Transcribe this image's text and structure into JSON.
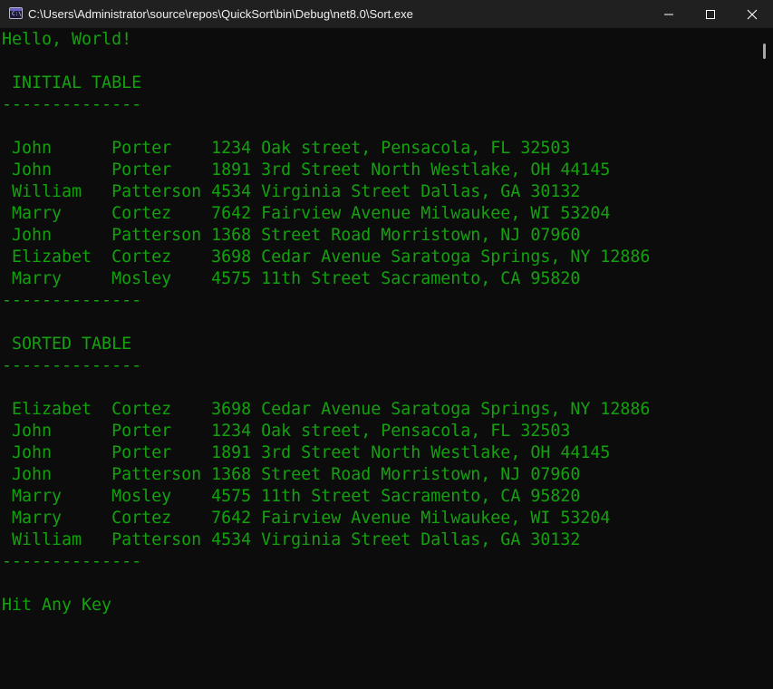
{
  "window": {
    "title": "C:\\Users\\Administrator\\source\\repos\\QuickSort\\bin\\Debug\\net8.0\\Sort.exe",
    "icon": "console-app-icon",
    "icon_glyph": "C:\\"
  },
  "controls": {
    "minimize": "minimize-icon",
    "maximize": "maximize-icon",
    "close": "close-icon"
  },
  "colors": {
    "text": "#13a10e",
    "background": "#0c0c0c",
    "titlebar": "#202020"
  },
  "console": {
    "lines": [
      "Hello, World!",
      "",
      " INITIAL TABLE",
      "--------------",
      "",
      " John      Porter    1234 Oak street, Pensacola, FL 32503",
      " John      Porter    1891 3rd Street North Westlake, OH 44145",
      " William   Patterson 4534 Virginia Street Dallas, GA 30132",
      " Marry     Cortez    7642 Fairview Avenue Milwaukee, WI 53204",
      " John      Patterson 1368 Street Road Morristown, NJ 07960",
      " Elizabet  Cortez    3698 Cedar Avenue Saratoga Springs, NY 12886",
      " Marry     Mosley    4575 11th Street Sacramento, CA 95820",
      "--------------",
      "",
      " SORTED TABLE",
      "--------------",
      "",
      " Elizabet  Cortez    3698 Cedar Avenue Saratoga Springs, NY 12886",
      " John      Porter    1234 Oak street, Pensacola, FL 32503",
      " John      Porter    1891 3rd Street North Westlake, OH 44145",
      " John      Patterson 1368 Street Road Morristown, NJ 07960",
      " Marry     Mosley    4575 11th Street Sacramento, CA 95820",
      " Marry     Cortez    7642 Fairview Avenue Milwaukee, WI 53204",
      " William   Patterson 4534 Virginia Street Dallas, GA 30132",
      "--------------",
      "",
      "Hit Any Key"
    ]
  }
}
